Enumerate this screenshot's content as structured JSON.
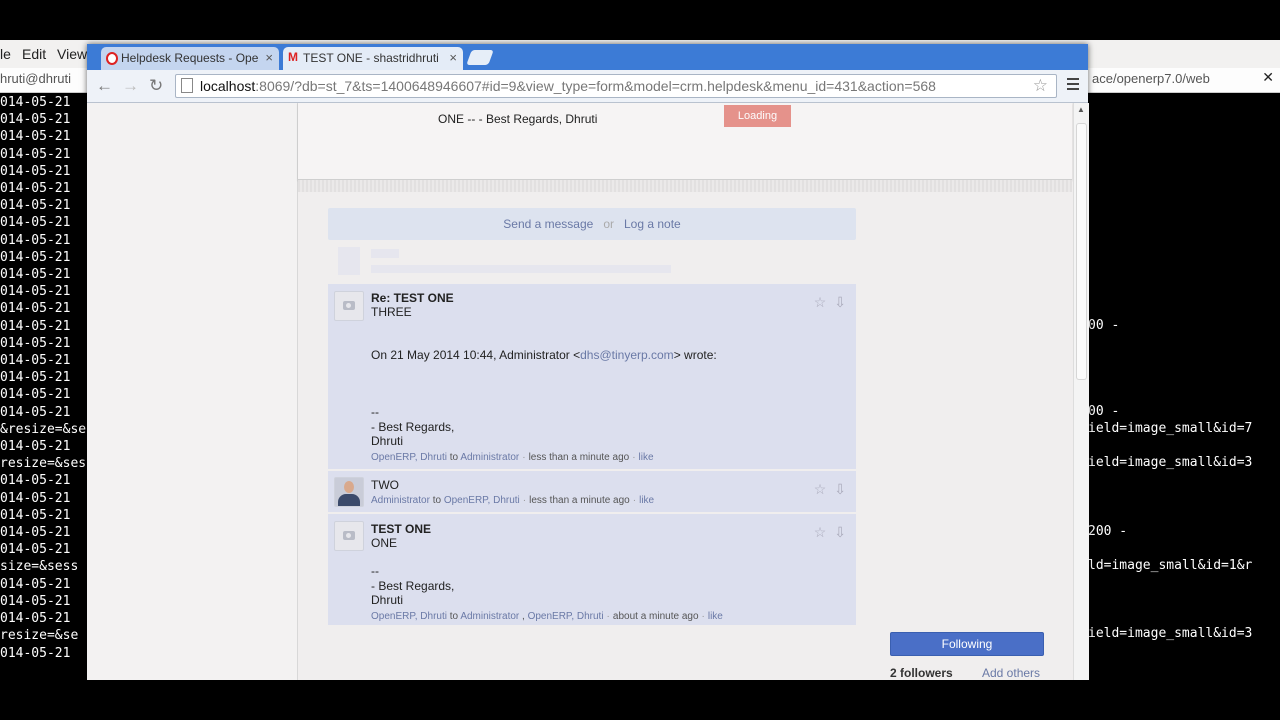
{
  "terminal": {
    "menu": [
      "le",
      "Edit",
      "View"
    ],
    "title_left": "hruti@dhruti",
    "title_right": "ace/openerp7.0/web",
    "left_lines": [
      "014-05-21",
      "014-05-21",
      "014-05-21",
      "014-05-21",
      "014-05-21",
      "014-05-21",
      "014-05-21",
      "014-05-21",
      "014-05-21",
      "014-05-21",
      "014-05-21",
      "014-05-21",
      "014-05-21",
      "014-05-21",
      "014-05-21",
      "014-05-21",
      "014-05-21",
      "014-05-21",
      "014-05-21",
      "&resize=&se",
      "014-05-21",
      "resize=&ses",
      "014-05-21",
      "014-05-21",
      "014-05-21",
      "014-05-21",
      "014-05-21",
      "size=&sess",
      "014-05-21",
      "014-05-21",
      "014-05-21",
      "resize=&se",
      "014-05-21"
    ],
    "right_lines": [
      "00 -",
      "00 -",
      "ield=image_small&id=7",
      "ield=image_small&id=3",
      "200 -",
      "ld=image_small&id=1&r",
      "ield=image_small&id=3"
    ]
  },
  "browser": {
    "tabs": [
      {
        "label": "Helpdesk Requests - Ope",
        "favicon": "opera-icon"
      },
      {
        "label": "TEST ONE - shastridhruti",
        "favicon": "gmail-icon"
      }
    ],
    "url_host": "localhost",
    "url_rest": ":8069/?db=st_7&ts=1400648946607#id=9&view_type=form&model=crm.helpdesk&menu_id=431&action=568"
  },
  "page": {
    "form_text": "ONE -- - Best Regards, Dhruti",
    "loading": "Loading",
    "composer": {
      "send": "Send a message",
      "or": "or",
      "log": "Log a note"
    },
    "messages": [
      {
        "subject": "Re: TEST ONE",
        "body1": "THREE",
        "quote_prefix": "On 21 May 2014 10:44, Administrator <",
        "quote_email": "dhs@tinyerp.com",
        "quote_suffix": "> wrote:",
        "sig1": "--",
        "sig2": "- Best Regards,",
        "sig3": "Dhruti",
        "author": "OpenERP, Dhruti",
        "to": "to",
        "recipient": "Administrator",
        "time": "less than a minute ago",
        "like": "like"
      },
      {
        "body1": "TWO",
        "author": "Administrator",
        "to": "to",
        "recipient": "OpenERP, Dhruti",
        "time": "less than a minute ago",
        "like": "like"
      },
      {
        "subject": "TEST ONE",
        "body1": "ONE",
        "sig1": "--",
        "sig2": "- Best Regards,",
        "sig3": "Dhruti",
        "author": "OpenERP, Dhruti",
        "to": "to",
        "recipient": "Administrator",
        "sep": ",",
        "recipient2": "OpenERP, Dhruti",
        "time": "about a minute ago",
        "like": "like"
      }
    ],
    "following": "Following",
    "followers": "2 followers",
    "add_others": "Add others"
  }
}
